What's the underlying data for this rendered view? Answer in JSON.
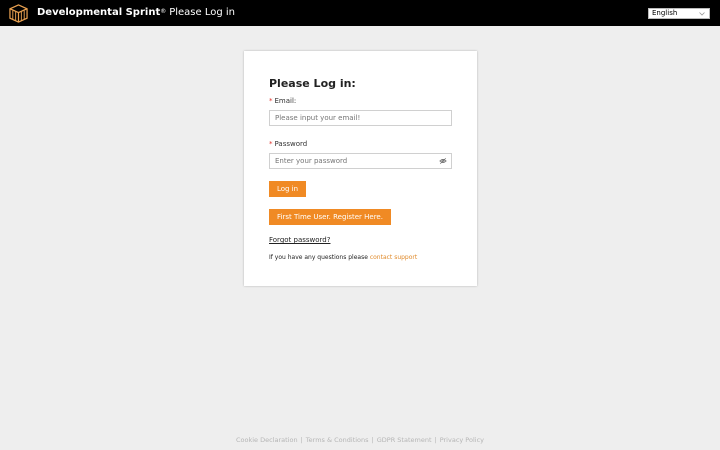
{
  "header": {
    "brand": "Developmental Sprint",
    "trademark": "®",
    "page_title": "Please Log in",
    "logo_icon": "cube-logo-icon",
    "language": {
      "selected": "English"
    }
  },
  "login": {
    "heading": "Please Log in:",
    "required_marker": "*",
    "email": {
      "label": "Email:",
      "placeholder": "Please input your email!",
      "value": ""
    },
    "password": {
      "label": "Password",
      "placeholder": "Enter your password",
      "value": "",
      "toggle_icon": "eye-slash-icon"
    },
    "login_button": "Log in",
    "register_button": "First Time User. Register Here.",
    "forgot_link": "Forgot password?",
    "questions_text": "If you have any questions please",
    "support_link": "contact support"
  },
  "footer": {
    "links": [
      "Cookie Declaration",
      "Terms & Conditions",
      "GDPR Statement",
      "Privacy Policy"
    ],
    "separator": "|"
  },
  "colors": {
    "accent": "#f08a24",
    "topbar": "#000000",
    "background": "#eeeeee",
    "required": "#e0322b",
    "link": "#e08a2a"
  }
}
